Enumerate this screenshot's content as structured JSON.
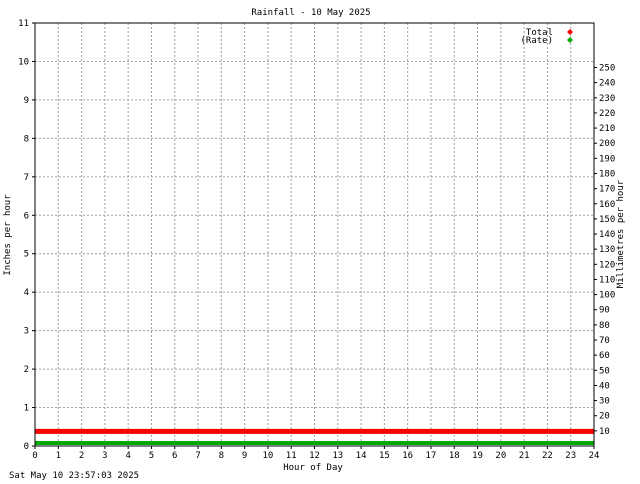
{
  "chart_data": {
    "type": "line",
    "title": "Rainfall - 10 May 2025",
    "xlabel": "Hour of Day",
    "ylabel": "Inches per hour",
    "y2label": "Millimetres per hour",
    "xlim": [
      0,
      24
    ],
    "ylim": [
      0,
      11
    ],
    "y2lim": [
      0,
      279.4
    ],
    "x_ticks": [
      0,
      1,
      2,
      3,
      4,
      5,
      6,
      7,
      8,
      9,
      10,
      11,
      12,
      13,
      14,
      15,
      16,
      17,
      18,
      19,
      20,
      21,
      22,
      23,
      24
    ],
    "y_ticks": [
      0,
      1,
      2,
      3,
      4,
      5,
      6,
      7,
      8,
      9,
      10,
      11
    ],
    "y2_ticks": [
      10,
      20,
      30,
      40,
      50,
      60,
      70,
      80,
      90,
      100,
      110,
      120,
      130,
      140,
      150,
      160,
      170,
      180,
      190,
      200,
      210,
      220,
      230,
      240,
      250
    ],
    "grid": true,
    "legend_position": "top-right",
    "series": [
      {
        "name": "Total",
        "color": "#ff0000",
        "x": [
          0,
          24
        ],
        "y": [
          0.38,
          0.38
        ]
      },
      {
        "name": "(Rate)",
        "color": "#00aa00",
        "x": [
          0,
          24
        ],
        "y": [
          0.0,
          0.0
        ]
      }
    ]
  },
  "footer": {
    "timestamp": "Sat May 10 23:57:03 2025"
  }
}
